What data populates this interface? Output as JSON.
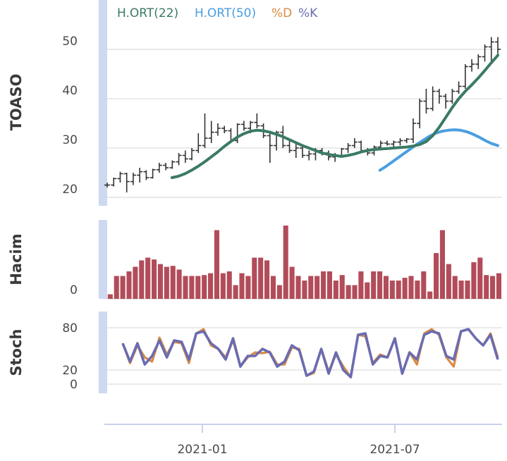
{
  "chart_data": {
    "type": "line",
    "x_ticks": [
      "2021-01",
      "2021-07"
    ],
    "legend": [
      {
        "label": "H.ORT(22)",
        "color": "#3a7a64"
      },
      {
        "label": "H.ORT(50)",
        "color": "#4a9ee0"
      },
      {
        "label": "%D",
        "color": "#d98b45"
      },
      {
        "label": "%K",
        "color": "#6a6cb0"
      }
    ],
    "panels": {
      "price": {
        "ylabel": "TOASO",
        "yticks": [
          20,
          30,
          40,
          50
        ],
        "ylim": [
          18,
          55
        ],
        "ohlc": [
          [
            22.5,
            22.0,
            23.0,
            22.5
          ],
          [
            22.5,
            22.2,
            24.0,
            23.8
          ],
          [
            23.8,
            23.0,
            25.2,
            24.8
          ],
          [
            24.8,
            21.0,
            25.0,
            23.2
          ],
          [
            23.2,
            22.5,
            25.0,
            24.5
          ],
          [
            24.5,
            23.0,
            26.0,
            25.2
          ],
          [
            25.2,
            23.5,
            25.5,
            24.0
          ],
          [
            24.0,
            23.8,
            25.8,
            25.6
          ],
          [
            25.6,
            25.0,
            27.0,
            26.5
          ],
          [
            26.5,
            25.5,
            27.0,
            26.0
          ],
          [
            26.0,
            25.8,
            27.5,
            27.2
          ],
          [
            27.2,
            26.5,
            29.0,
            28.5
          ],
          [
            28.5,
            27.0,
            29.5,
            27.8
          ],
          [
            27.8,
            27.5,
            30.0,
            29.5
          ],
          [
            29.5,
            29.0,
            33.0,
            30.5
          ],
          [
            30.5,
            30.0,
            37.0,
            32.0
          ],
          [
            32.0,
            31.0,
            35.5,
            33.2
          ],
          [
            33.2,
            32.5,
            35.0,
            34.0
          ],
          [
            34.0,
            33.0,
            34.5,
            33.5
          ],
          [
            33.5,
            31.0,
            34.0,
            31.5
          ],
          [
            31.5,
            31.0,
            35.0,
            34.8
          ],
          [
            34.8,
            33.5,
            35.5,
            34.0
          ],
          [
            34.0,
            33.0,
            35.5,
            35.2
          ],
          [
            35.2,
            34.0,
            37.0,
            34.5
          ],
          [
            34.5,
            32.0,
            35.0,
            32.5
          ],
          [
            32.5,
            27.0,
            33.5,
            30.5
          ],
          [
            30.5,
            29.5,
            33.5,
            33.2
          ],
          [
            33.2,
            30.0,
            34.5,
            30.5
          ],
          [
            30.5,
            29.0,
            31.5,
            29.5
          ],
          [
            29.5,
            28.0,
            31.0,
            30.0
          ],
          [
            30.0,
            28.0,
            30.5,
            28.5
          ],
          [
            28.5,
            27.5,
            29.5,
            28.8
          ],
          [
            28.8,
            27.5,
            30.0,
            29.5
          ],
          [
            29.5,
            28.5,
            30.0,
            29.0
          ],
          [
            29.0,
            27.5,
            29.5,
            28.2
          ],
          [
            28.2,
            27.2,
            29.0,
            28.5
          ],
          [
            28.5,
            28.0,
            30.0,
            29.8
          ],
          [
            29.8,
            29.0,
            31.0,
            30.5
          ],
          [
            30.5,
            30.0,
            32.0,
            31.2
          ],
          [
            31.2,
            29.0,
            31.5,
            29.5
          ],
          [
            29.5,
            28.5,
            30.0,
            29.0
          ],
          [
            29.0,
            28.5,
            30.5,
            30.2
          ],
          [
            30.2,
            30.0,
            31.5,
            31.0
          ],
          [
            31.0,
            30.5,
            31.5,
            30.8
          ],
          [
            30.8,
            30.0,
            31.5,
            31.2
          ],
          [
            31.2,
            30.5,
            32.0,
            31.5
          ],
          [
            31.5,
            31.0,
            32.0,
            31.8
          ],
          [
            31.8,
            31.0,
            36.0,
            35.0
          ],
          [
            35.0,
            34.0,
            40.0,
            39.5
          ],
          [
            39.5,
            37.0,
            42.0,
            38.0
          ],
          [
            38.0,
            37.5,
            42.5,
            41.5
          ],
          [
            41.5,
            39.0,
            42.0,
            40.5
          ],
          [
            40.5,
            38.0,
            41.0,
            39.5
          ],
          [
            39.5,
            39.0,
            42.0,
            41.5
          ],
          [
            41.5,
            41.0,
            43.5,
            42.5
          ],
          [
            42.5,
            42.0,
            47.0,
            46.5
          ],
          [
            46.5,
            45.5,
            48.0,
            47.0
          ],
          [
            47.0,
            46.0,
            49.0,
            48.5
          ],
          [
            48.5,
            47.5,
            51.0,
            50.5
          ],
          [
            50.5,
            47.0,
            52.5,
            51.5
          ],
          [
            51.5,
            49.0,
            52.5,
            50.0
          ]
        ],
        "ma22": [
          null,
          null,
          null,
          null,
          null,
          null,
          null,
          null,
          null,
          null,
          null,
          null,
          null,
          null,
          null,
          null,
          null,
          null,
          null,
          null,
          null,
          24.0,
          24.3,
          24.8,
          25.5,
          26.3,
          27.2,
          28.2,
          29.2,
          30.3,
          31.3,
          32.2,
          32.9,
          33.4,
          33.6,
          33.5,
          33.2,
          32.8,
          32.3,
          31.7,
          31.1,
          30.5,
          30.0,
          29.5,
          29.0,
          28.7,
          28.5,
          28.3,
          28.5,
          28.8,
          29.2,
          29.5,
          29.7,
          29.8,
          29.9,
          30.0,
          30.1,
          30.2,
          30.4,
          30.7,
          31.3,
          32.5,
          34.2,
          36.2,
          38.2,
          40.0,
          41.5,
          42.8,
          44.2,
          45.7,
          47.3,
          48.8
        ],
        "ma50": [
          null,
          null,
          null,
          null,
          null,
          null,
          null,
          null,
          null,
          null,
          null,
          null,
          null,
          null,
          null,
          null,
          null,
          null,
          null,
          null,
          null,
          null,
          null,
          null,
          null,
          null,
          null,
          null,
          null,
          null,
          null,
          null,
          null,
          null,
          null,
          null,
          null,
          null,
          null,
          null,
          null,
          null,
          null,
          null,
          null,
          null,
          null,
          null,
          null,
          null,
          null,
          25.5,
          26.3,
          27.2,
          28.1,
          29.0,
          29.9,
          30.8,
          31.6,
          32.4,
          33.0,
          33.4,
          33.6,
          33.7,
          33.6,
          33.3,
          32.8,
          32.2,
          31.5,
          30.9,
          30.5
        ]
      },
      "volume": {
        "ylabel": "Hacim",
        "yticks": [
          0
        ],
        "values": [
          0.5,
          2.5,
          2.5,
          3.0,
          3.5,
          4.2,
          4.5,
          4.3,
          3.8,
          3.5,
          3.6,
          3.2,
          2.5,
          2.5,
          2.5,
          2.6,
          2.8,
          7.5,
          2.8,
          3.0,
          1.5,
          2.8,
          2.5,
          4.5,
          4.5,
          4.2,
          2.5,
          1.5,
          8.0,
          3.5,
          2.5,
          2.0,
          2.5,
          2.5,
          3.0,
          3.0,
          2.0,
          2.6,
          1.5,
          1.5,
          3.0,
          1.8,
          3.0,
          3.0,
          2.5,
          2.0,
          2.0,
          2.3,
          2.5,
          2.0,
          3.0,
          0.8,
          5.0,
          7.5,
          3.8,
          2.5,
          2.0,
          2.0,
          4.0,
          4.5,
          2.6,
          2.5,
          2.8
        ]
      },
      "stoch": {
        "ylabel": "Stoch",
        "yticks": [
          0,
          20,
          80
        ],
        "ylim": [
          -5,
          95
        ],
        "pct_k": [
          58,
          32,
          58,
          28,
          40,
          62,
          38,
          62,
          60,
          35,
          72,
          75,
          58,
          50,
          35,
          65,
          25,
          40,
          40,
          50,
          45,
          25,
          32,
          55,
          48,
          12,
          18,
          50,
          15,
          45,
          20,
          10,
          70,
          72,
          28,
          40,
          38,
          65,
          15,
          45,
          35,
          70,
          75,
          72,
          40,
          35,
          75,
          78,
          65,
          55,
          70,
          35
        ],
        "pct_d": [
          58,
          30,
          55,
          38,
          32,
          66,
          42,
          60,
          58,
          30,
          72,
          78,
          55,
          50,
          38,
          62,
          25,
          38,
          45,
          44,
          46,
          28,
          28,
          52,
          50,
          12,
          16,
          50,
          18,
          42,
          25,
          10,
          70,
          68,
          30,
          42,
          38,
          65,
          15,
          45,
          28,
          72,
          78,
          70,
          38,
          25,
          75,
          78,
          65,
          55,
          72,
          38
        ]
      }
    }
  }
}
